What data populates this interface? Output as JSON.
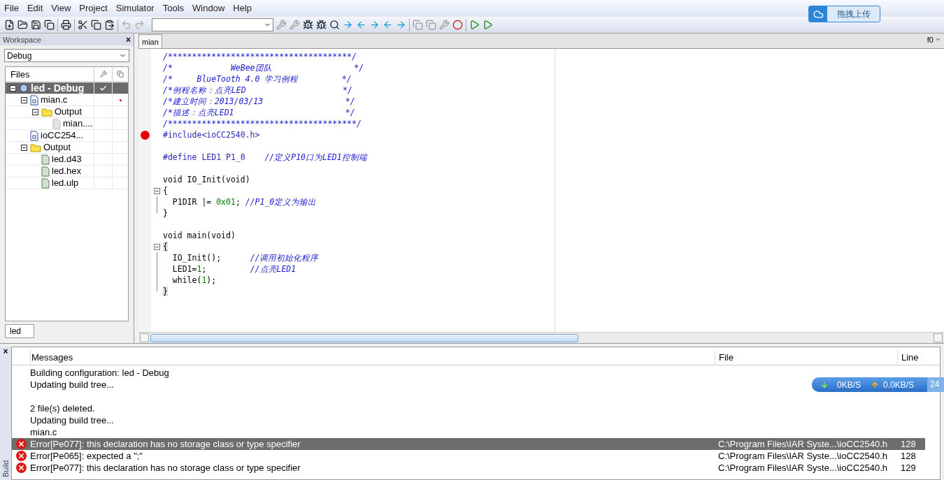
{
  "menu": [
    "File",
    "Edit",
    "View",
    "Project",
    "Simulator",
    "Tools",
    "Window",
    "Help"
  ],
  "upload_button": {
    "label": "拖拽上传"
  },
  "workspace": {
    "title": "Workspace",
    "close": "×",
    "config": "Debug",
    "files_header": "Files",
    "bottom_tab": "led",
    "tree": [
      {
        "label": "led - Debug",
        "kind": "project",
        "selected": true,
        "checked": true,
        "modified": false,
        "expanded": true,
        "children": [
          {
            "label": "mian.c",
            "kind": "c-file",
            "selected": false,
            "checked": false,
            "modified": true,
            "expanded": true,
            "children": [
              {
                "label": "Output",
                "kind": "folder",
                "selected": false,
                "checked": false,
                "modified": false,
                "expanded": true,
                "children": [
                  {
                    "label": "mian....",
                    "kind": "grey-file",
                    "selected": false,
                    "checked": false,
                    "modified": false
                  }
                ]
              }
            ]
          },
          {
            "label": "ioCC254...",
            "kind": "h-file",
            "selected": false,
            "checked": false,
            "modified": false
          },
          {
            "label": "Output",
            "kind": "folder",
            "selected": false,
            "checked": false,
            "modified": false,
            "expanded": true,
            "children": [
              {
                "label": "led.d43",
                "kind": "green-file",
                "selected": false,
                "checked": false,
                "modified": false
              },
              {
                "label": "led.hex",
                "kind": "green-file",
                "selected": false,
                "checked": false,
                "modified": false
              },
              {
                "label": "led.ulp",
                "kind": "green-file",
                "selected": false,
                "checked": false,
                "modified": false
              }
            ]
          }
        ]
      }
    ]
  },
  "editor": {
    "tab": "mian",
    "selector": "f0",
    "lines": [
      {
        "tokens": [
          {
            "kind": "comment",
            "text": "/**************************************/"
          }
        ]
      },
      {
        "tokens": [
          {
            "kind": "comment",
            "text": "/*            WeBee团队                 */"
          }
        ]
      },
      {
        "tokens": [
          {
            "kind": "comment",
            "text": "/*     BlueTooth 4.0 学习例程         */"
          }
        ]
      },
      {
        "tokens": [
          {
            "kind": "comment",
            "text": "/*例程名称：点亮LED                    */"
          }
        ]
      },
      {
        "tokens": [
          {
            "kind": "comment",
            "text": "/*建立时间：2013/03/13                 */"
          }
        ]
      },
      {
        "tokens": [
          {
            "kind": "comment",
            "text": "/*描述：点亮LED1                       */"
          }
        ]
      },
      {
        "tokens": [
          {
            "kind": "comment",
            "text": "/***************************************/"
          }
        ]
      },
      {
        "breakpoint": true,
        "tokens": [
          {
            "kind": "preproc",
            "text": "#include<ioCC2540.h>"
          }
        ]
      },
      {
        "kind": "blank"
      },
      {
        "tokens": [
          {
            "kind": "preproc",
            "text": "#define LED1 P1_0    "
          },
          {
            "kind": "comment",
            "text": "//定义P10口为LED1控制端"
          }
        ]
      },
      {
        "kind": "blank"
      },
      {
        "tokens": [
          {
            "kind": "code",
            "text": "void IO_Init(void)"
          }
        ]
      },
      {
        "kind": "fold-start",
        "tokens": [
          {
            "kind": "code",
            "text": "{"
          }
        ]
      },
      {
        "kind": "fold-body",
        "tokens": [
          {
            "kind": "code",
            "text": "  P1DIR |= "
          },
          {
            "kind": "number",
            "text": "0x01"
          },
          {
            "kind": "code",
            "text": "; "
          },
          {
            "kind": "comment",
            "text": "//P1_0定义为输出"
          }
        ]
      },
      {
        "kind": "fold-end",
        "tokens": [
          {
            "kind": "code",
            "text": "}"
          }
        ]
      },
      {
        "kind": "blank"
      },
      {
        "tokens": [
          {
            "kind": "code",
            "text": "void main(void)"
          }
        ]
      },
      {
        "kind": "fold-start",
        "highlight": true,
        "tokens": [
          {
            "kind": "code",
            "text": "{"
          }
        ]
      },
      {
        "kind": "fold-body",
        "tokens": [
          {
            "kind": "code",
            "text": "  IO_Init();      "
          },
          {
            "kind": "comment",
            "text": "//调用初始化程序"
          }
        ]
      },
      {
        "kind": "fold-body",
        "tokens": [
          {
            "kind": "code",
            "text": "  LED1="
          },
          {
            "kind": "number",
            "text": "1"
          },
          {
            "kind": "code",
            "text": ";         "
          },
          {
            "kind": "comment",
            "text": "//点亮LED1"
          }
        ]
      },
      {
        "kind": "fold-body",
        "tokens": [
          {
            "kind": "code",
            "text": "  while("
          },
          {
            "kind": "number",
            "text": "1"
          },
          {
            "kind": "code",
            "text": ");"
          }
        ]
      },
      {
        "kind": "fold-end",
        "highlight": true,
        "tokens": [
          {
            "kind": "code",
            "text": "}"
          }
        ]
      }
    ]
  },
  "build": {
    "tab": "Build",
    "close": "×",
    "columns": [
      "Messages",
      "File",
      "Line"
    ],
    "rows": [
      {
        "kind": "info",
        "selected": false,
        "message": "Building configuration: led - Debug"
      },
      {
        "kind": "info",
        "selected": false,
        "message": "Updating build tree..."
      },
      {
        "kind": "blank"
      },
      {
        "kind": "info",
        "selected": false,
        "message": "2  file(s) deleted."
      },
      {
        "kind": "info",
        "selected": false,
        "message": "Updating build tree..."
      },
      {
        "kind": "info",
        "selected": false,
        "message": "mian.c"
      },
      {
        "kind": "error",
        "selected": true,
        "message": "Error[Pe077]: this declaration has no storage class or type specifier",
        "file": "C:\\Program Files\\IAR Syste...\\ioCC2540.h",
        "line": "128"
      },
      {
        "kind": "error",
        "selected": false,
        "message": "Error[Pe065]: expected a \";\"",
        "file": "C:\\Program Files\\IAR Syste...\\ioCC2540.h",
        "line": "128"
      },
      {
        "kind": "error",
        "selected": false,
        "message": "Error[Pe077]: this declaration has no storage class or type specifier",
        "file": "C:\\Program Files\\IAR Syste...\\ioCC2540.h",
        "line": "129"
      }
    ]
  },
  "speed_widget": {
    "down": "0KB/S",
    "up": "0.0KB/S",
    "extra": "24"
  }
}
